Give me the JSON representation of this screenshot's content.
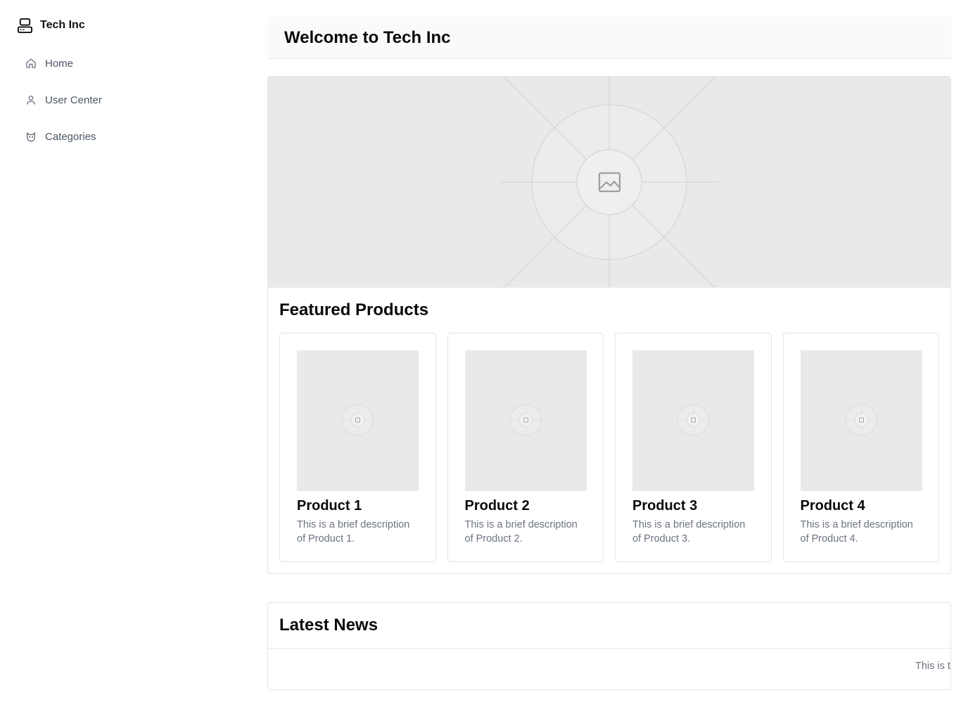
{
  "brand": {
    "name": "Tech Inc",
    "icon": "computer-icon"
  },
  "nav": {
    "items": [
      {
        "label": "Home",
        "icon": "home-icon"
      },
      {
        "label": "User Center",
        "icon": "user-icon"
      },
      {
        "label": "Categories",
        "icon": "category-icon"
      }
    ]
  },
  "header": {
    "title": "Welcome to Tech Inc"
  },
  "hero": {
    "icon": "image-placeholder-icon"
  },
  "featured": {
    "title": "Featured Products",
    "products": [
      {
        "name": "Product 1",
        "description": "This is a brief description of Product 1."
      },
      {
        "name": "Product 2",
        "description": "This is a brief description of Product 2."
      },
      {
        "name": "Product 3",
        "description": "This is a brief description of Product 3."
      },
      {
        "name": "Product 4",
        "description": "This is a brief description of Product 4."
      }
    ]
  },
  "news": {
    "title": "Latest News",
    "ticker_text": "This is t"
  },
  "colors": {
    "text_primary": "#0a0a0a",
    "text_muted": "#6b7280",
    "placeholder_bg": "#e9e9e9",
    "border": "#e2e4e7",
    "header_bg": "#f9fafa"
  }
}
